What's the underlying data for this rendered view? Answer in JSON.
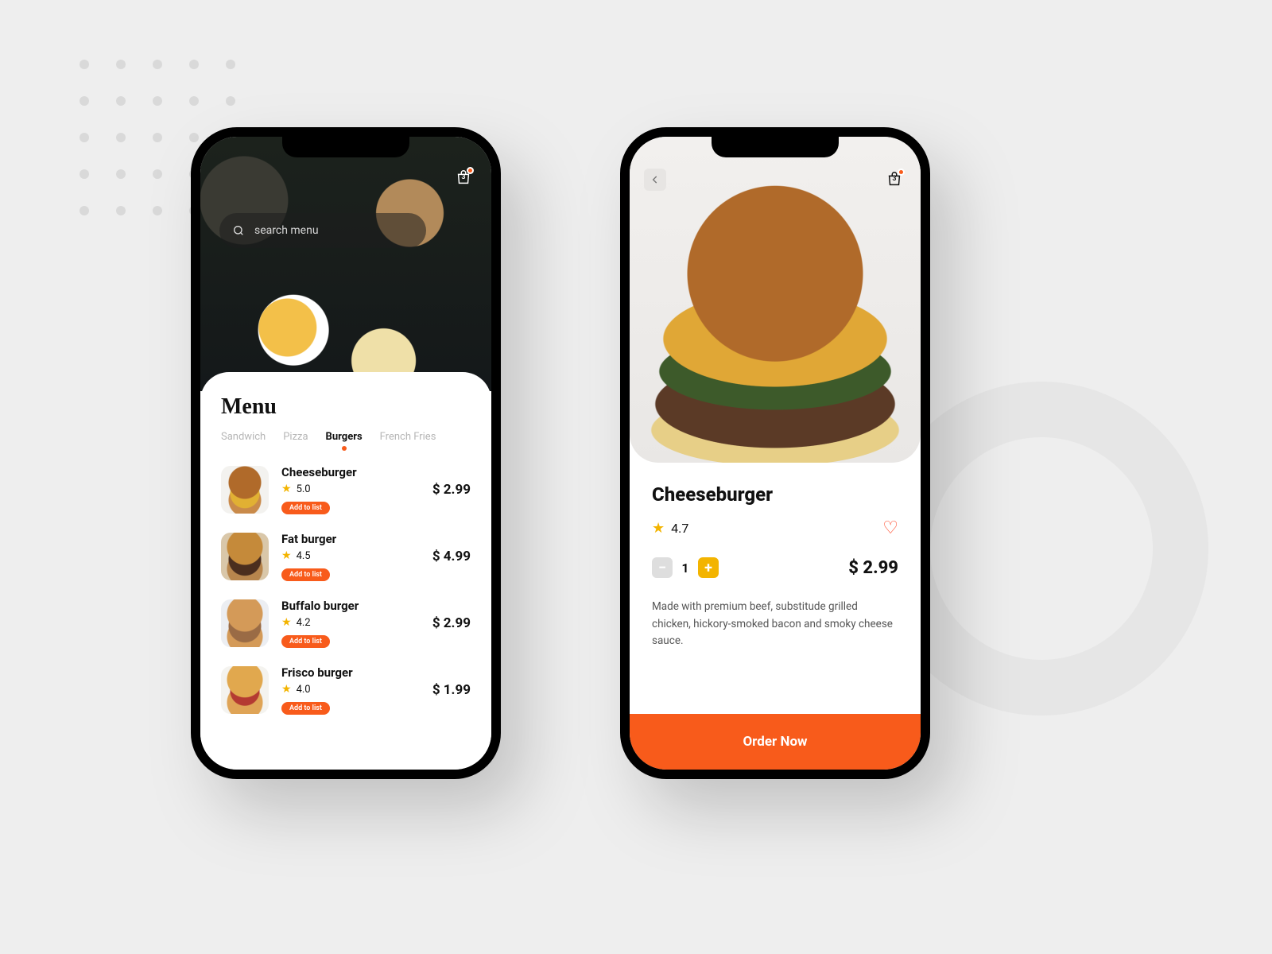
{
  "cart_count": "3",
  "search": {
    "placeholder": "search menu"
  },
  "menu": {
    "title": "Menu",
    "tabs": [
      "Sandwich",
      "Pizza",
      "Burgers",
      "French Fries"
    ],
    "active_tab": "Burgers",
    "items": [
      {
        "name": "Cheeseburger",
        "rating": "5.0",
        "price": "$ 2.99",
        "add_label": "Add to list"
      },
      {
        "name": "Fat burger",
        "rating": "4.5",
        "price": "$ 4.99",
        "add_label": "Add to list"
      },
      {
        "name": "Buffalo burger",
        "rating": "4.2",
        "price": "$ 2.99",
        "add_label": "Add to list"
      },
      {
        "name": "Frisco burger",
        "rating": "4.0",
        "price": "$ 1.99",
        "add_label": "Add to list"
      }
    ]
  },
  "detail": {
    "title": "Cheeseburger",
    "rating": "4.7",
    "qty": "1",
    "price": "$ 2.99",
    "description": "Made with premium beef, substitude grilled chicken, hickory-smoked bacon and smoky cheese sauce.",
    "order_label": "Order Now"
  }
}
